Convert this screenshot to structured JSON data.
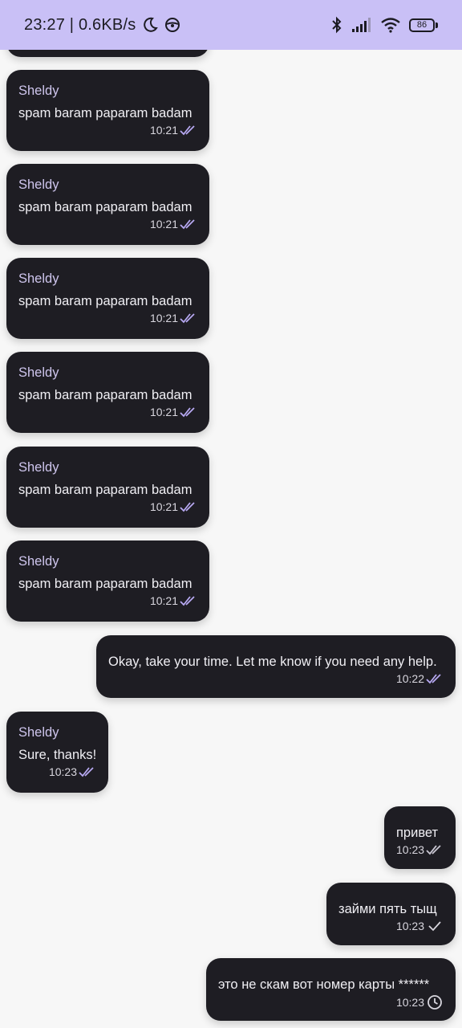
{
  "status_bar": {
    "time_speed": "23:27 | 0.6KB/s",
    "battery": "86",
    "icons": [
      "moon-icon",
      "steering-icon",
      "bluetooth-icon",
      "signal-icon",
      "wifi-icon",
      "battery-icon"
    ]
  },
  "colors": {
    "status_bar_bg": "#c9c0f6",
    "bubble_bg": "#1e1d23",
    "sender_color": "#cfc6ee",
    "read_check": "#b7a9f2",
    "page_bg": "#f7f7f7"
  },
  "messages": [
    {
      "sender": "Sheldy",
      "text": "spam baram paparam badam",
      "time": "10:21",
      "status": "read"
    },
    {
      "sender": "Sheldy",
      "text": "spam baram paparam badam",
      "time": "10:21",
      "status": "read"
    },
    {
      "sender": "Sheldy",
      "text": "spam baram paparam badam",
      "time": "10:21",
      "status": "read"
    },
    {
      "sender": "Sheldy",
      "text": "spam baram paparam badam",
      "time": "10:21",
      "status": "read"
    },
    {
      "sender": "Sheldy",
      "text": "spam baram paparam badam",
      "time": "10:21",
      "status": "read"
    },
    {
      "sender": "Sheldy",
      "text": "spam baram paparam badam",
      "time": "10:21",
      "status": "read"
    },
    {
      "text": "Okay, take your time. Let me know if you need any help.",
      "time": "10:22",
      "status": "read"
    },
    {
      "sender": "Sheldy",
      "text": "Sure, thanks!",
      "time": "10:23",
      "status": "read"
    },
    {
      "text": "привет",
      "time": "10:23",
      "status": "read"
    },
    {
      "text": "займи пять тыщ",
      "time": "10:23",
      "status": "sent"
    },
    {
      "text": "это не скам вот номер карты ******",
      "time": "10:23",
      "status": "pending"
    }
  ]
}
